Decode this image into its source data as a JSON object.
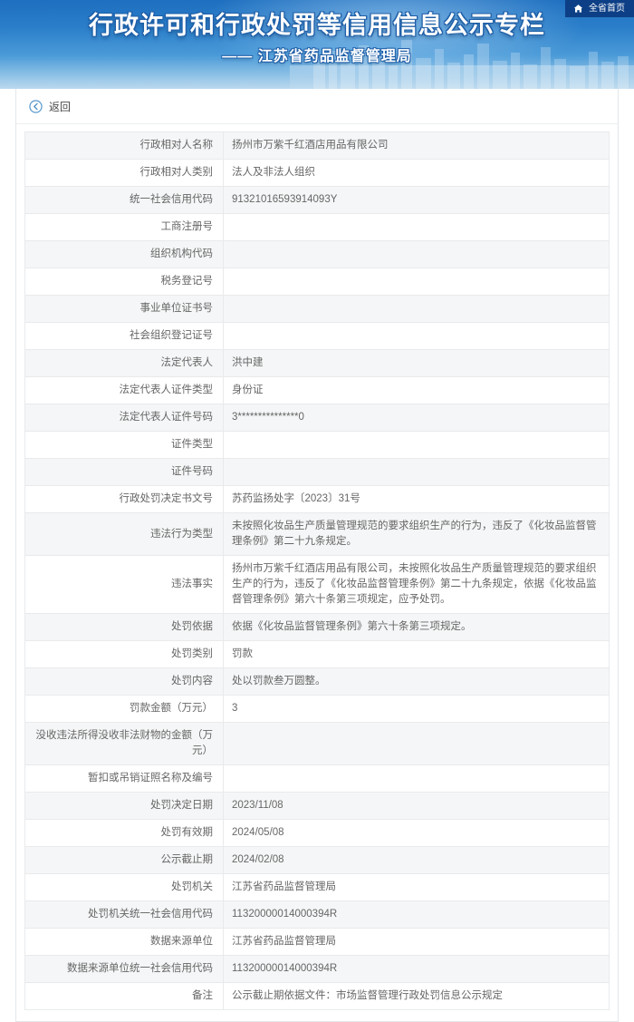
{
  "header": {
    "title": "行政许可和行政处罚等信用信息公示专栏",
    "subtitle": "—— 江苏省药品监督管理局",
    "home_link_label": "全省首页",
    "home_icon": "home-icon",
    "banner_bg_color": "#2a7ec9",
    "home_link_bg_color": "#0d3f86"
  },
  "toolbar": {
    "back_label": "返回",
    "back_icon": "arrow-left-circle-icon"
  },
  "table": {
    "rows": [
      {
        "label": "行政相对人名称",
        "value": "扬州市万紫千红酒店用品有限公司"
      },
      {
        "label": "行政相对人类别",
        "value": "法人及非法人组织"
      },
      {
        "label": "统一社会信用代码",
        "value": "91321016593914093Y"
      },
      {
        "label": "工商注册号",
        "value": ""
      },
      {
        "label": "组织机构代码",
        "value": ""
      },
      {
        "label": "税务登记号",
        "value": ""
      },
      {
        "label": "事业单位证书号",
        "value": ""
      },
      {
        "label": "社会组织登记证号",
        "value": ""
      },
      {
        "label": "法定代表人",
        "value": "洪中建"
      },
      {
        "label": "法定代表人证件类型",
        "value": "身份证"
      },
      {
        "label": "法定代表人证件号码",
        "value": "3***************0"
      },
      {
        "label": "证件类型",
        "value": ""
      },
      {
        "label": "证件号码",
        "value": ""
      },
      {
        "label": "行政处罚决定书文号",
        "value": "苏药监扬处字〔2023〕31号"
      },
      {
        "label": "违法行为类型",
        "value": "未按照化妆品生产质量管理规范的要求组织生产的行为，违反了《化妆品监督管理条例》第二十九条规定。"
      },
      {
        "label": "违法事实",
        "value": "扬州市万紫千红酒店用品有限公司，未按照化妆品生产质量管理规范的要求组织生产的行为，违反了《化妆品监督管理条例》第二十九条规定，依据《化妆品监督管理条例》第六十条第三项规定，应予处罚。"
      },
      {
        "label": "处罚依据",
        "value": "依据《化妆品监督管理条例》第六十条第三项规定。"
      },
      {
        "label": "处罚类别",
        "value": "罚款"
      },
      {
        "label": "处罚内容",
        "value": "处以罚款叁万圆整。"
      },
      {
        "label": "罚款金额（万元）",
        "value": "3"
      },
      {
        "label": "没收违法所得没收非法财物的金额（万元）",
        "value": ""
      },
      {
        "label": "暂扣或吊销证照名称及编号",
        "value": ""
      },
      {
        "label": "处罚决定日期",
        "value": "2023/11/08"
      },
      {
        "label": "处罚有效期",
        "value": "2024/05/08"
      },
      {
        "label": "公示截止期",
        "value": "2024/02/08"
      },
      {
        "label": "处罚机关",
        "value": "江苏省药品监督管理局"
      },
      {
        "label": "处罚机关统一社会信用代码",
        "value": "11320000014000394R"
      },
      {
        "label": "数据来源单位",
        "value": "江苏省药品监督管理局"
      },
      {
        "label": "数据来源单位统一社会信用代码",
        "value": "11320000014000394R"
      },
      {
        "label": "备注",
        "value": "公示截止期依据文件：市场监督管理行政处罚信息公示规定"
      }
    ]
  }
}
